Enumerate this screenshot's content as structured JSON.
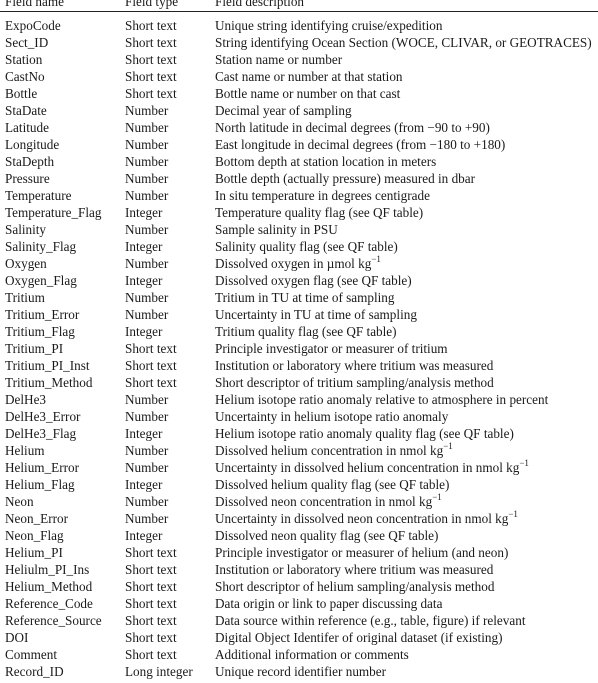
{
  "table": {
    "headers": {
      "field_name": "Field name",
      "field_type": "Field type",
      "field_description": "Field description"
    },
    "rows": [
      {
        "name": "ExpoCode",
        "type": "Short text",
        "desc": "Unique string identifying cruise/expedition",
        "sup": ""
      },
      {
        "name": "Sect_ID",
        "type": "Short text",
        "desc": "String identifying Ocean Section (WOCE, CLIVAR, or GEOTRACES)",
        "sup": ""
      },
      {
        "name": "Station",
        "type": "Short text",
        "desc": "Station name or number",
        "sup": ""
      },
      {
        "name": "CastNo",
        "type": "Short text",
        "desc": "Cast name or number at that station",
        "sup": ""
      },
      {
        "name": "Bottle",
        "type": "Short text",
        "desc": "Bottle name or number on that cast",
        "sup": ""
      },
      {
        "name": "StaDate",
        "type": "Number",
        "desc": "Decimal year of sampling",
        "sup": ""
      },
      {
        "name": "Latitude",
        "type": "Number",
        "desc": "North latitude in decimal degrees (from −90 to +90)",
        "sup": ""
      },
      {
        "name": "Longitude",
        "type": "Number",
        "desc": "East longitude in decimal degrees (from −180 to +180)",
        "sup": ""
      },
      {
        "name": "StaDepth",
        "type": "Number",
        "desc": "Bottom depth at station location in meters",
        "sup": ""
      },
      {
        "name": "Pressure",
        "type": "Number",
        "desc": "Bottle depth (actually pressure) measured in dbar",
        "sup": ""
      },
      {
        "name": "Temperature",
        "type": "Number",
        "desc": "In situ temperature in degrees centigrade",
        "sup": ""
      },
      {
        "name": "Temperature_Flag",
        "type": "Integer",
        "desc": "Temperature quality flag (see QF table)",
        "sup": ""
      },
      {
        "name": "Salinity",
        "type": "Number",
        "desc": "Sample salinity in PSU",
        "sup": ""
      },
      {
        "name": "Salinity_Flag",
        "type": "Integer",
        "desc": "Salinity quality flag (see QF table)",
        "sup": ""
      },
      {
        "name": "Oxygen",
        "type": "Number",
        "desc": "Dissolved oxygen in µmol kg",
        "sup": "−1"
      },
      {
        "name": "Oxygen_Flag",
        "type": "Integer",
        "desc": "Dissolved oxygen flag (see QF table)",
        "sup": ""
      },
      {
        "name": "Tritium",
        "type": "Number",
        "desc": "Tritium in TU at time of sampling",
        "sup": ""
      },
      {
        "name": "Tritium_Error",
        "type": "Number",
        "desc": "Uncertainty in TU at time of sampling",
        "sup": ""
      },
      {
        "name": "Tritium_Flag",
        "type": "Integer",
        "desc": "Tritium quality flag (see QF table)",
        "sup": ""
      },
      {
        "name": "Tritium_PI",
        "type": "Short text",
        "desc": "Principle investigator or measurer of tritium",
        "sup": ""
      },
      {
        "name": "Tritium_PI_Inst",
        "type": "Short text",
        "desc": "Institution or laboratory where tritium was measured",
        "sup": ""
      },
      {
        "name": "Tritium_Method",
        "type": "Short text",
        "desc": "Short descriptor of tritium sampling/analysis method",
        "sup": ""
      },
      {
        "name": "DelHe3",
        "type": "Number",
        "desc": "Helium isotope ratio anomaly relative to atmosphere in percent",
        "sup": ""
      },
      {
        "name": "DelHe3_Error",
        "type": "Number",
        "desc": "Uncertainty in helium isotope ratio anomaly",
        "sup": ""
      },
      {
        "name": "DelHe3_Flag",
        "type": "Integer",
        "desc": "Helium isotope ratio anomaly quality flag (see QF table)",
        "sup": ""
      },
      {
        "name": "Helium",
        "type": "Number",
        "desc": "Dissolved helium concentration in nmol kg",
        "sup": "−1"
      },
      {
        "name": "Helium_Error",
        "type": "Number",
        "desc": "Uncertainty in dissolved helium concentration in nmol kg",
        "sup": "−1"
      },
      {
        "name": "Helium_Flag",
        "type": "Integer",
        "desc": "Dissolved helium quality flag (see QF table)",
        "sup": ""
      },
      {
        "name": "Neon",
        "type": "Number",
        "desc": "Dissolved neon concentration in nmol kg",
        "sup": "−1"
      },
      {
        "name": "Neon_Error",
        "type": "Number",
        "desc": "Uncertainty in dissolved neon concentration in nmol kg",
        "sup": "−1"
      },
      {
        "name": "Neon_Flag",
        "type": "Integer",
        "desc": "Dissolved neon quality flag (see QF table)",
        "sup": ""
      },
      {
        "name": "Helium_PI",
        "type": "Short text",
        "desc": "Principle investigator or measurer of helium (and neon)",
        "sup": ""
      },
      {
        "name": "Heliulm_PI_Ins",
        "type": "Short text",
        "desc": "Institution or laboratory where tritium was measured",
        "sup": ""
      },
      {
        "name": "Helium_Method",
        "type": "Short text",
        "desc": "Short descriptor of helium sampling/analysis method",
        "sup": ""
      },
      {
        "name": "Reference_Code",
        "type": "Short text",
        "desc": "Data origin or link to paper discussing data",
        "sup": ""
      },
      {
        "name": "Reference_Source",
        "type": "Short text",
        "desc": "Data source within reference (e.g., table, figure) if relevant",
        "sup": ""
      },
      {
        "name": "DOI",
        "type": "Short text",
        "desc": "Digital Object Identifer of original dataset (if existing)",
        "sup": ""
      },
      {
        "name": "Comment",
        "type": "Short text",
        "desc": "Additional information or comments",
        "sup": ""
      },
      {
        "name": "Record_ID",
        "type": "Long integer",
        "desc": "Unique record identifier number",
        "sup": ""
      }
    ]
  }
}
